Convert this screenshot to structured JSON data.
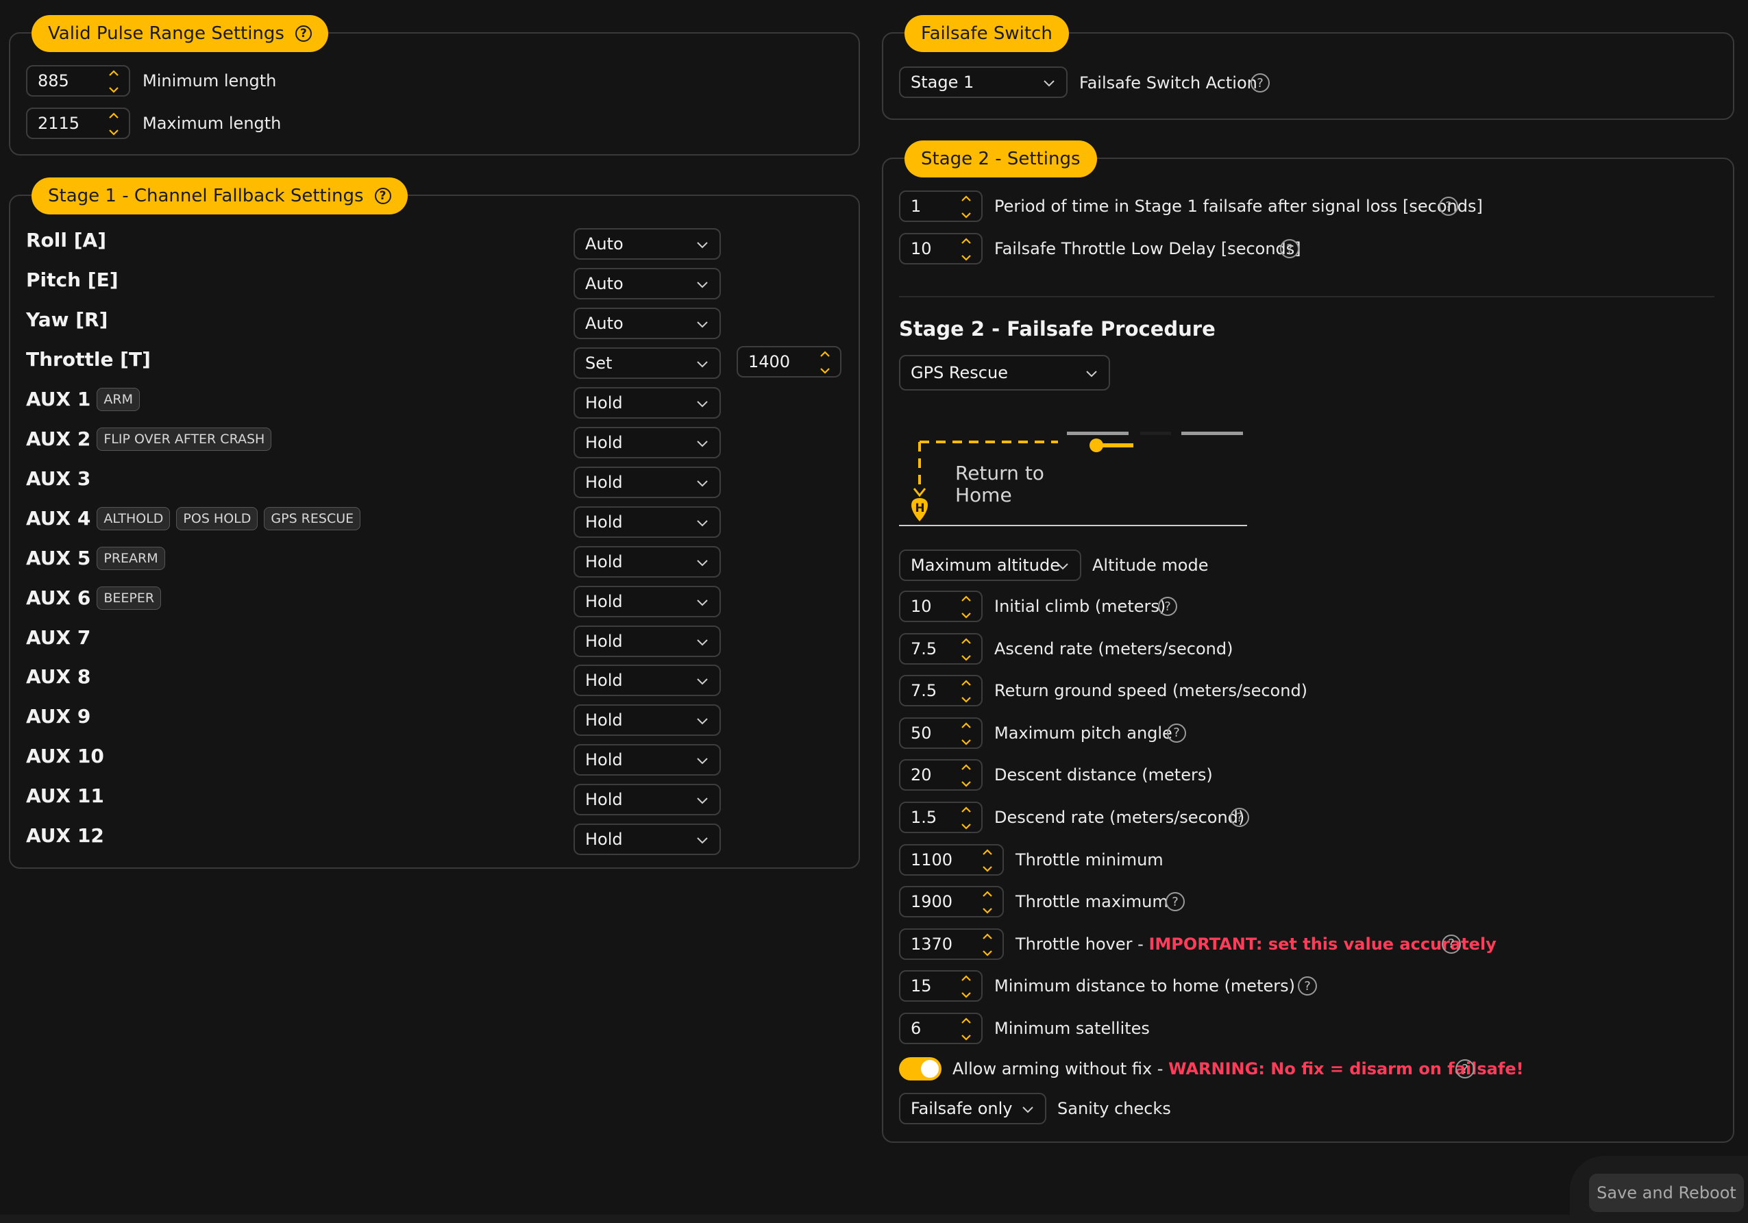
{
  "valid_pulse": {
    "title": "Valid Pulse Range Settings",
    "min_value": "885",
    "min_label": "Minimum length",
    "max_value": "2115",
    "max_label": "Maximum length"
  },
  "stage1": {
    "title": "Stage 1 - Channel Fallback Settings",
    "channels": [
      {
        "name": "Roll [A]",
        "tags": [],
        "mode": "Auto"
      },
      {
        "name": "Pitch [E]",
        "tags": [],
        "mode": "Auto"
      },
      {
        "name": "Yaw [R]",
        "tags": [],
        "mode": "Auto"
      },
      {
        "name": "Throttle [T]",
        "tags": [],
        "mode": "Set"
      },
      {
        "name": "AUX 1",
        "tags": [
          "ARM"
        ],
        "mode": "Hold"
      },
      {
        "name": "AUX 2",
        "tags": [
          "FLIP OVER AFTER CRASH"
        ],
        "mode": "Hold"
      },
      {
        "name": "AUX 3",
        "tags": [],
        "mode": "Hold"
      },
      {
        "name": "AUX 4",
        "tags": [
          "ALTHOLD",
          "POS HOLD",
          "GPS RESCUE"
        ],
        "mode": "Hold"
      },
      {
        "name": "AUX 5",
        "tags": [
          "PREARM"
        ],
        "mode": "Hold"
      },
      {
        "name": "AUX 6",
        "tags": [
          "BEEPER"
        ],
        "mode": "Hold"
      },
      {
        "name": "AUX 7",
        "tags": [],
        "mode": "Hold"
      },
      {
        "name": "AUX 8",
        "tags": [],
        "mode": "Hold"
      },
      {
        "name": "AUX 9",
        "tags": [],
        "mode": "Hold"
      },
      {
        "name": "AUX 10",
        "tags": [],
        "mode": "Hold"
      },
      {
        "name": "AUX 11",
        "tags": [],
        "mode": "Hold"
      },
      {
        "name": "AUX 12",
        "tags": [],
        "mode": "Hold"
      }
    ],
    "throttle_set_value": "1400"
  },
  "failsafe_switch": {
    "title": "Failsafe Switch",
    "selected": "Stage 1",
    "label": "Failsafe Switch Action"
  },
  "stage2": {
    "title": "Stage 2 - Settings",
    "period_value": "1",
    "period_label": "Period of time in Stage 1 failsafe after signal loss [seconds]",
    "throttle_low_value": "10",
    "throttle_low_label": "Failsafe Throttle Low Delay [seconds]",
    "procedure_heading": "Stage 2 - Failsafe Procedure",
    "procedure_selected": "GPS Rescue",
    "rth_line1": "Return to",
    "rth_line2": "Home",
    "home_marker": "H",
    "altitude_mode_value": "Maximum altitude",
    "altitude_mode_label": "Altitude mode",
    "fields": [
      {
        "value": "10",
        "label": "Initial climb (meters)",
        "help": true
      },
      {
        "value": "7.5",
        "label": "Ascend rate (meters/second)",
        "help": false
      },
      {
        "value": "7.5",
        "label": "Return ground speed (meters/second)",
        "help": false
      },
      {
        "value": "50",
        "label": "Maximum pitch angle",
        "help": true
      },
      {
        "value": "20",
        "label": "Descent distance (meters)",
        "help": false
      },
      {
        "value": "1.5",
        "label": "Descend rate (meters/second)",
        "help": true
      },
      {
        "value": "1100",
        "label": "Throttle minimum",
        "help": false
      },
      {
        "value": "1900",
        "label": "Throttle maximum",
        "help": true
      },
      {
        "value": "1370",
        "label": "Throttle hover - ",
        "warn": "IMPORTANT: set this value accurately",
        "help": true
      },
      {
        "value": "15",
        "label": "Minimum distance to home (meters)",
        "help": true
      },
      {
        "value": "6",
        "label": "Minimum satellites",
        "help": false
      }
    ],
    "allow_arming_label": "Allow arming without fix - ",
    "allow_arming_warning": "WARNING: No fix = disarm on failsafe!",
    "allow_arming_enabled": true,
    "sanity_value": "Failsafe only",
    "sanity_label": "Sanity checks"
  },
  "save_button": "Save and Reboot",
  "colors": {
    "accent": "#ffbb00",
    "warning": "#ff3d5a",
    "background": "#141414"
  },
  "icons": {
    "help": "?",
    "spinner": "chevron-up-down",
    "dropdown": "chevron-down"
  }
}
